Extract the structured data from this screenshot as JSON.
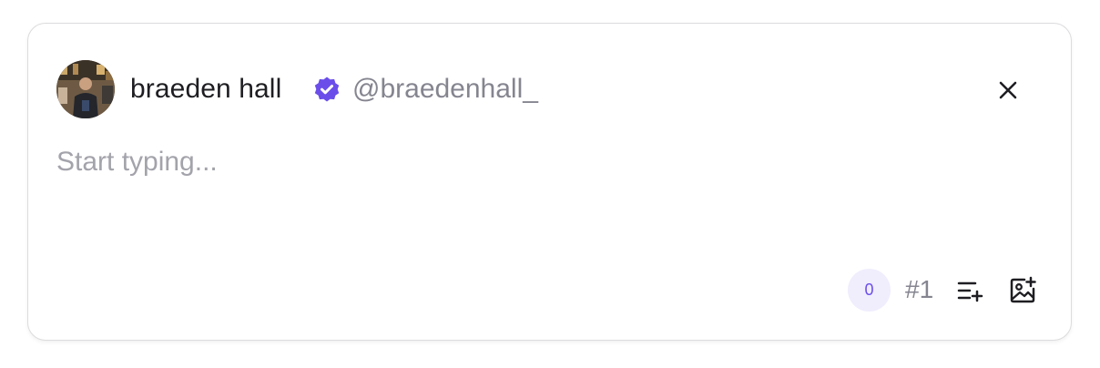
{
  "user": {
    "display_name": "braeden hall",
    "handle": "@braedenhall_",
    "verified": true,
    "avatar_icon": "user-avatar-photo"
  },
  "composer": {
    "placeholder": "Start typing...",
    "value": ""
  },
  "footer": {
    "char_count": "0",
    "thread_index": "#1",
    "add_thread_icon": "list-plus-icon",
    "add_image_icon": "image-plus-icon"
  },
  "icons": {
    "close": "close-icon",
    "verified": "verified-badge-icon"
  },
  "colors": {
    "accent": "#6b4eea",
    "accent_soft": "#f0edfd",
    "text": "#1e1e22",
    "muted": "#858590",
    "placeholder": "#a3a3ab",
    "border": "#dcdcde"
  }
}
